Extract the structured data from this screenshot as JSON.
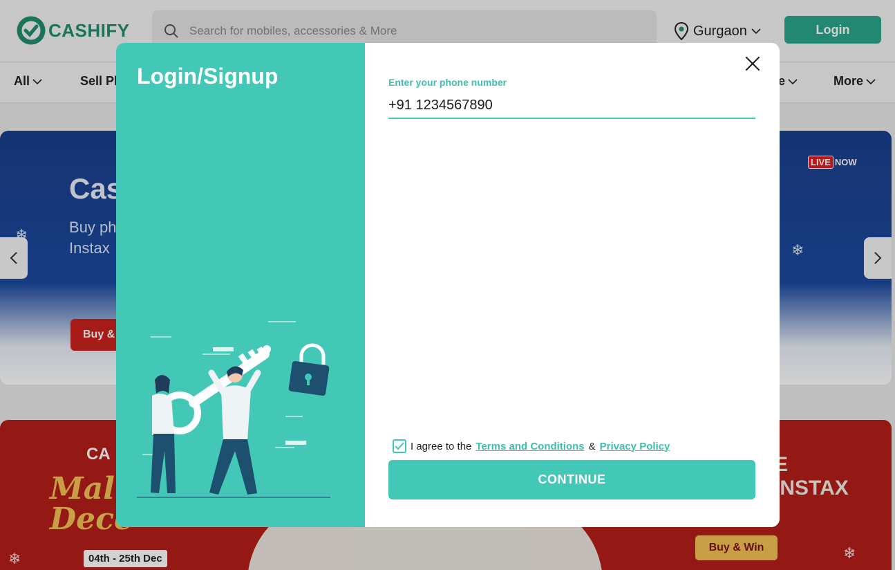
{
  "header": {
    "logo_text": "CASHIFY",
    "search_placeholder": "Search for mobiles, accessories & More",
    "location": "Gurgaon",
    "login_label": "Login"
  },
  "nav": {
    "items": [
      {
        "label": "All"
      },
      {
        "label": "Sell Ph"
      },
      {
        "label": "e"
      },
      {
        "label": "More"
      }
    ]
  },
  "banner1": {
    "title": "Cas",
    "subtitle_line1": "Buy ph",
    "subtitle_line2": "Instax",
    "button_label": "Buy &",
    "live_label": "LIVE",
    "now_label": "NOW"
  },
  "banner2": {
    "brand": "CA",
    "festival_line1": "Mal",
    "festival_line2": "Dece",
    "date_text": "04th - 25th Dec",
    "right_line1": "E",
    "right_line2": "INSTAX",
    "buy_win_label": "Buy & Win"
  },
  "modal": {
    "title": "Login/Signup",
    "phone_label": "Enter your phone number",
    "phone_value": "+91 1234567890",
    "agree_text": "I agree to the",
    "terms_link": "Terms and Conditions",
    "amp": "&",
    "privacy_link": "Privacy Policy",
    "continue_label": "CONTINUE",
    "accent_color": "#43c8b8"
  }
}
